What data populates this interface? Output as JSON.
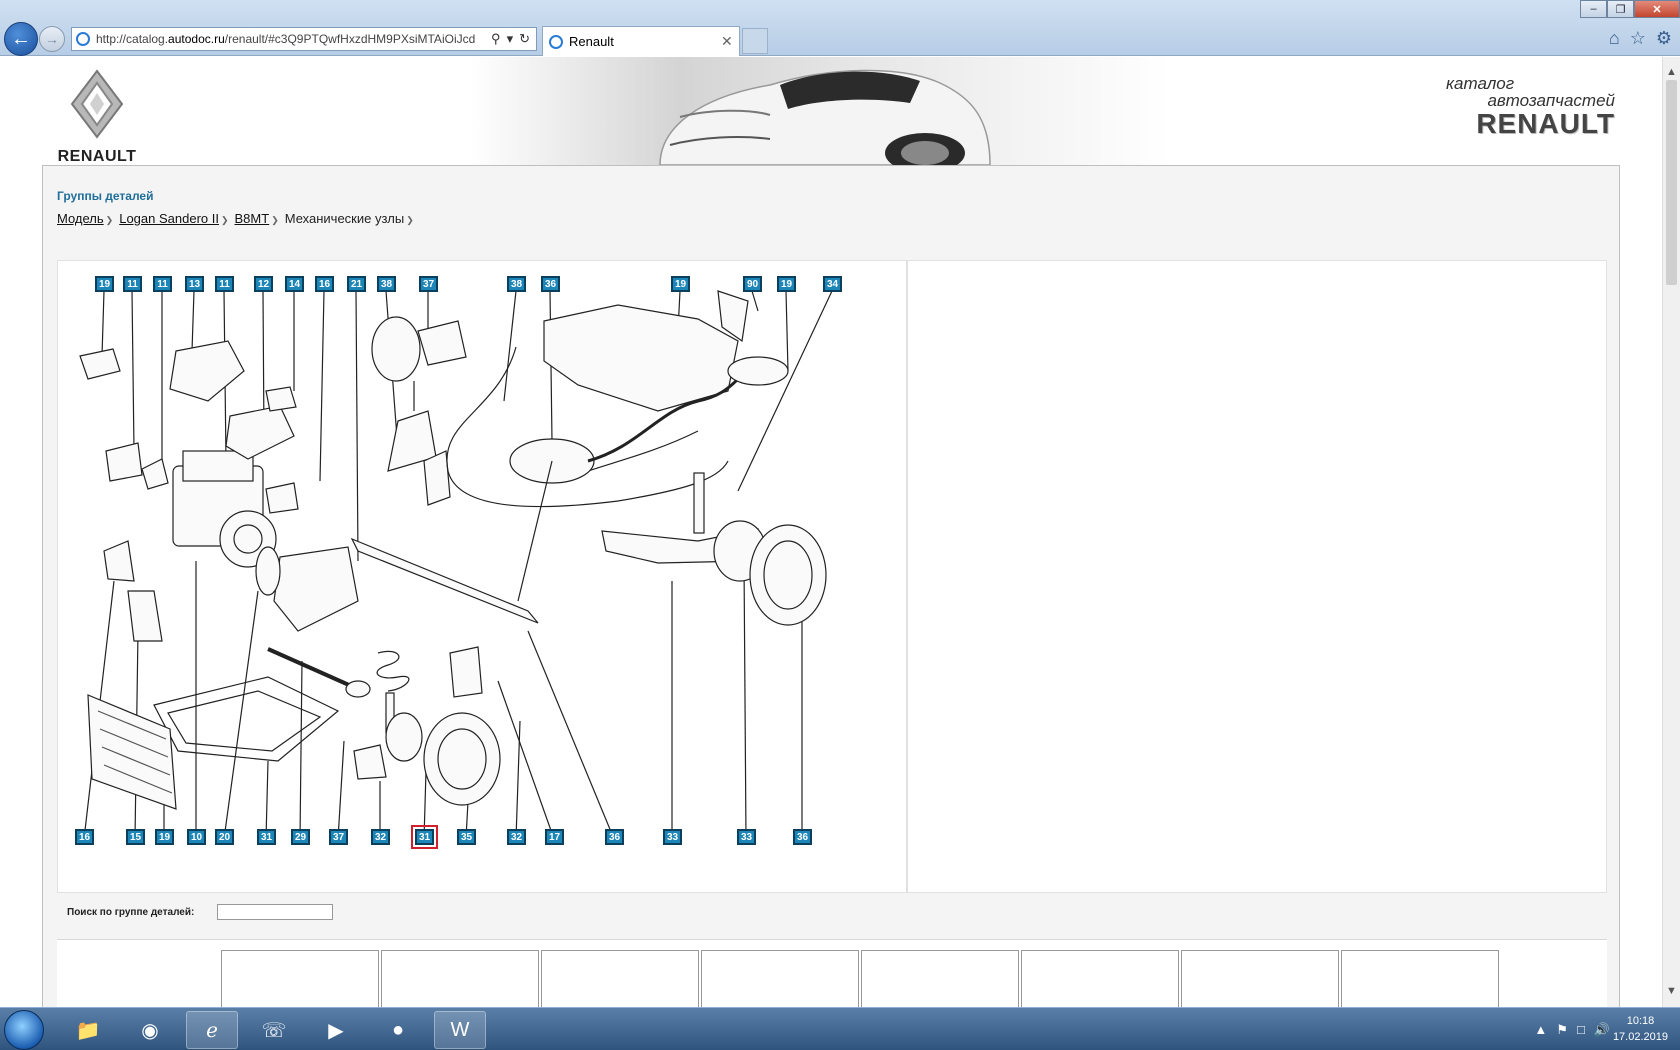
{
  "browser": {
    "url_prefix": "http://catalog.",
    "url_domain": "autodoc.ru",
    "url_suffix": "/renault/#c3Q9PTQwfHxzdHM9PXsiMTAiOiJcd",
    "tab_title": "Renault"
  },
  "header": {
    "logo_text": "RENAULT",
    "brand_line1": "каталог",
    "brand_line2": "автозапчастей",
    "brand_line3": "RENAULT"
  },
  "content": {
    "section_title": "Группы деталей",
    "breadcrumb": [
      "Модель",
      "Logan Sandero II",
      "B8MT",
      "Механические узлы"
    ],
    "search_label": "Поиск по группе деталей:",
    "search_value": ""
  },
  "diagram": {
    "callouts_top": [
      "19",
      "11",
      "11",
      "13",
      "11",
      "12",
      "14",
      "16",
      "21",
      "38",
      "37",
      "38",
      "36",
      "19",
      "90",
      "19",
      "34"
    ],
    "callouts_bottom": [
      "16",
      "15",
      "19",
      "10",
      "20",
      "31",
      "29",
      "37",
      "32",
      "31",
      "35",
      "32",
      "17",
      "36",
      "33",
      "33",
      "36"
    ],
    "selected": "31"
  },
  "taskbar": {
    "time": "10:18",
    "date": "17.02.2019"
  }
}
